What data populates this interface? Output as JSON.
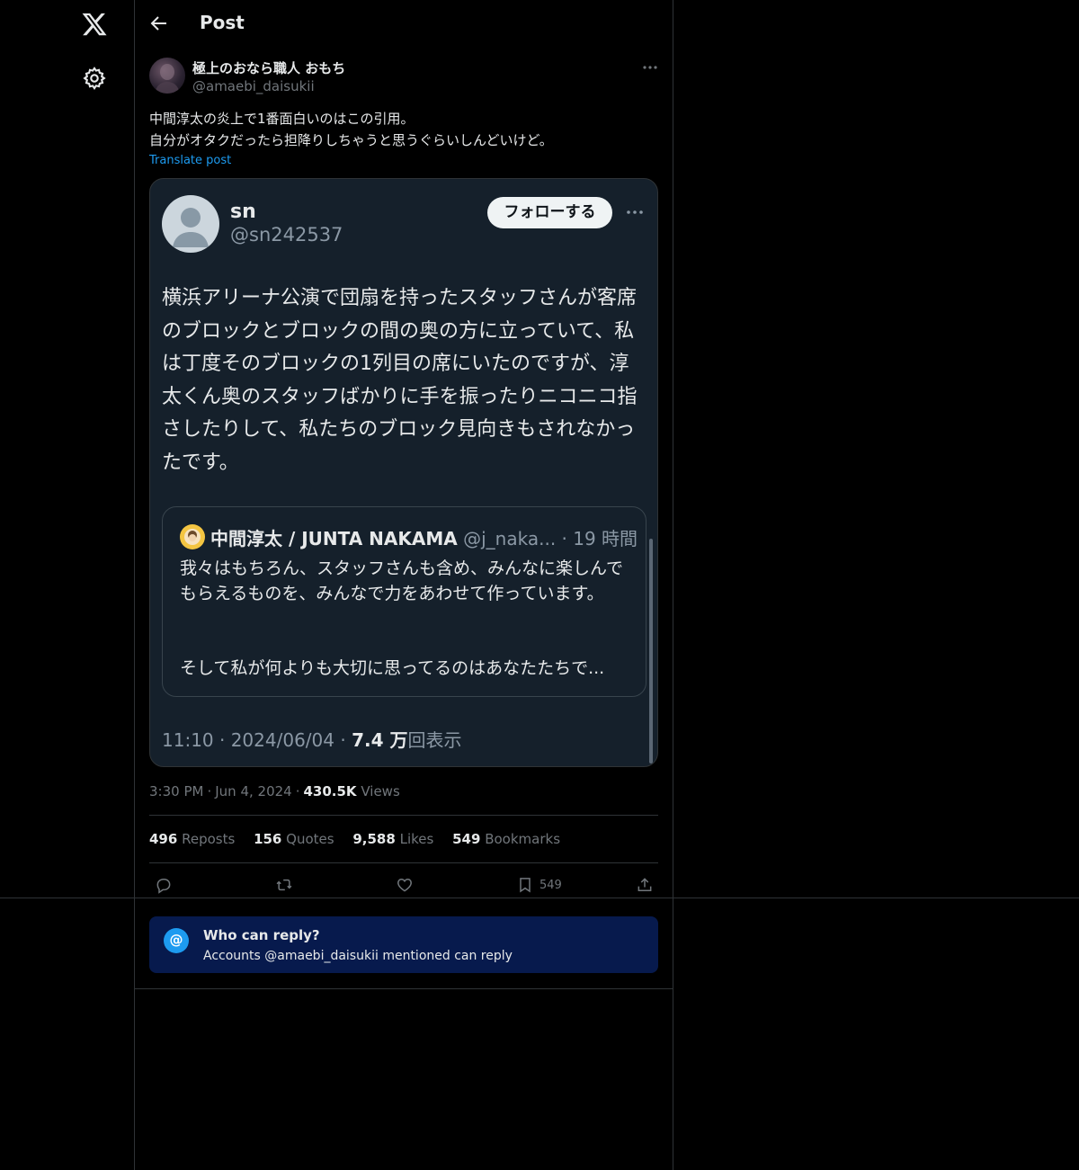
{
  "nav": {
    "logo_icon": "x-logo-icon",
    "settings_icon": "gear-icon"
  },
  "header": {
    "title": "Post",
    "back_icon": "arrow-left-icon"
  },
  "post": {
    "author_name": "極上のおなら職人 おもち",
    "author_handle": "@amaebi_daisukii",
    "text_line1": "中間淳太の炎上で1番面白いのはこの引用。",
    "text_line2": "自分がオタクだったら担降りしちゃうと思うぐらいしんどいけど。",
    "translate_label": "Translate post",
    "time": "3:30 PM",
    "date": "Jun 4, 2024",
    "views_count": "430.5K",
    "views_label": "Views",
    "dot": "·"
  },
  "screenshot": {
    "name": "sn",
    "handle": "@sn242537",
    "follow_label": "フォローする",
    "body": "横浜アリーナ公演で団扇を持ったスタッフさんが客席のブロックとブロックの間の奥の方に立っていて、私は丁度そのブロックの1列目の席にいたのですが、淳太くん奥のスタッフばかりに手を振ったりニコニコ指さしたりして、私たちのブロック見向きもされなかったです。",
    "quote": {
      "name": "中間淳太 / JUNTA NAKAMA",
      "handle_time": "@j_naka... · 19 時間",
      "body": "我々はもちろん、スタッフさんも含め、みんなに楽しんでもらえるものを、みんなで力をあわせて作っています。",
      "body2": "そして私が何よりも大切に思ってるのはあなたたちで..."
    },
    "footer_time": "11:10 · 2024/06/04 · ",
    "footer_views": "7.4 万",
    "footer_views_label": "回表示"
  },
  "stats": {
    "reposts_count": "496",
    "reposts_label": "Reposts",
    "quotes_count": "156",
    "quotes_label": "Quotes",
    "likes_count": "9,588",
    "likes_label": "Likes",
    "bookmarks_count": "549",
    "bookmarks_label": "Bookmarks"
  },
  "actions": {
    "bookmark_count": "549"
  },
  "reply": {
    "icon_glyph": "@",
    "title": "Who can reply?",
    "subtitle": "Accounts @amaebi_daisukii mentioned can reply"
  }
}
